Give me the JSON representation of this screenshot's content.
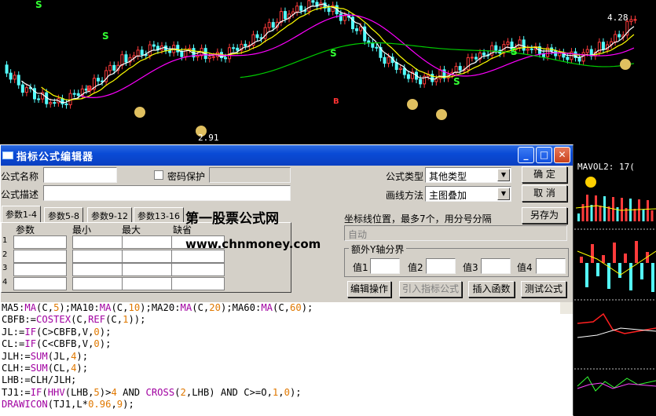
{
  "chart": {
    "high_label": "4.28",
    "low_label": "2.91",
    "mavol_label": "MAVOL2: 17(",
    "signal_labels": {
      "S": "S",
      "B": "B",
      "coin": "$"
    }
  },
  "window": {
    "title": "指标公式编辑器",
    "controls": {
      "minimize": "_",
      "maximize": "□",
      "close": "✕"
    }
  },
  "form": {
    "name_label": "公式名称",
    "name_value": "",
    "password_label": "密码保护",
    "desc_label": "公式描述",
    "desc_value": "",
    "type_label": "公式类型",
    "type_value": "其他类型",
    "draw_label": "画线方法",
    "draw_value": "主图叠加",
    "coord_label": "坐标线位置，最多7个，用分号分隔",
    "coord_value": "自动",
    "extra_y_title": "额外Y轴分界",
    "value_labels": [
      "值1",
      "值2",
      "值3",
      "值4"
    ]
  },
  "buttons": {
    "ok": "确  定",
    "cancel": "取  消",
    "save_as": "另存为",
    "edit_op": "编辑操作",
    "import": "引入指标公式",
    "insert_func": "插入函数",
    "test": "测试公式"
  },
  "tabs": [
    "参数1-4",
    "参数5-8",
    "参数9-12",
    "参数13-16"
  ],
  "param_headers": [
    "参数",
    "最小",
    "最大",
    "缺省"
  ],
  "param_rows": [
    "1",
    "2",
    "3",
    "4"
  ],
  "watermark": {
    "line1": "第一股票公式网",
    "line2": "www.chnmoney.com"
  },
  "code_lines": [
    "MA5:MA(C,5);MA10:MA(C,10);MA20:MA(C,20);MA60:MA(C,60);",
    "CBFB:=COSTEX(C,REF(C,1));",
    "JL:=IF(C>CBFB,V,0);",
    "CL:=IF(C<CBFB,V,0);",
    "JLH:=SUM(JL,4);",
    "CLH:=SUM(CL,4);",
    "LHB:=CLH/JLH;",
    "TJ1:=IF(HHV(LHB,5)>4 AND CROSS(2,LHB) AND C>=O,1,0);",
    "DRAWICON(TJ1,L*0.96,9);"
  ]
}
